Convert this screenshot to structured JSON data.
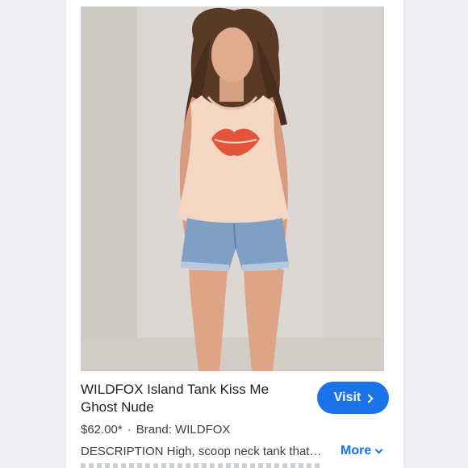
{
  "product": {
    "image_alt": "Model wearing tank top with red lips print and denim shorts",
    "title_line1": "WILDFOX Island Tank Kiss Me",
    "title_line2": "Ghost Nude",
    "price": "$62.00*",
    "brand": "Brand: WILDFOX",
    "description": "DESCRIPTION High, scoop neck tank that…"
  },
  "actions": {
    "visit_label": "Visit",
    "more_label": "More"
  },
  "colors": {
    "accent": "#1a73e8",
    "tank": "#f6d9c8",
    "lips": "#e2553a",
    "denim": "#7f9fc4"
  }
}
